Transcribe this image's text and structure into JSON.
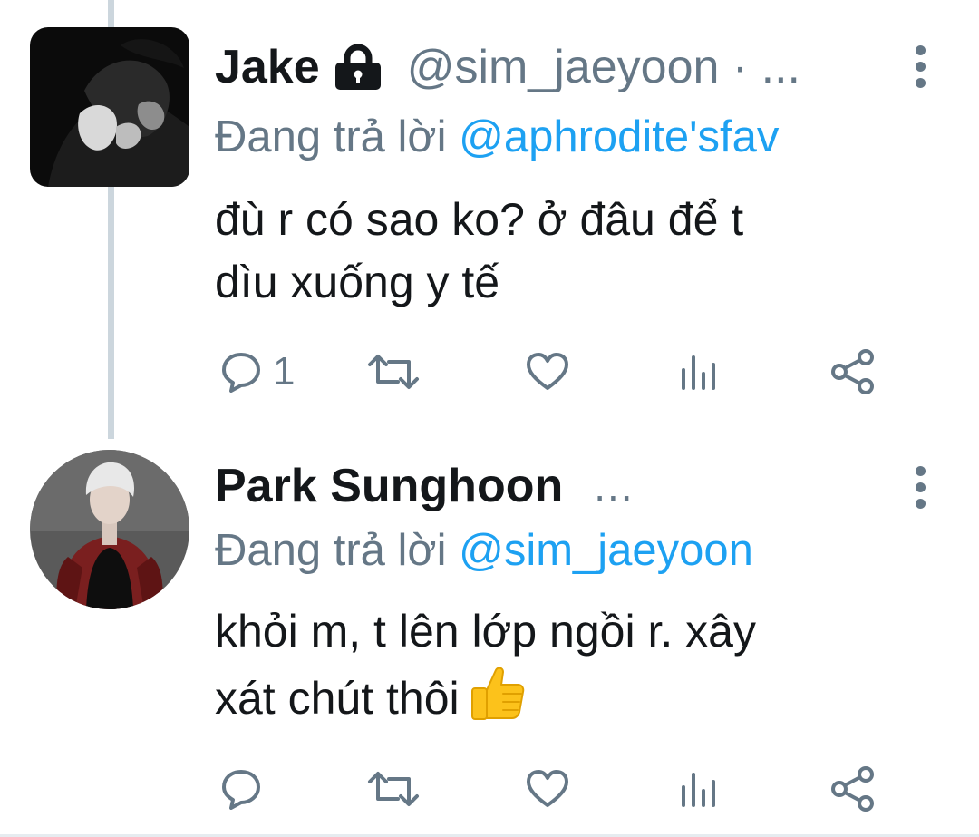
{
  "tweets": [
    {
      "name": "Jake",
      "protected_icon": "lock-icon",
      "handle": "@sim_jaeyoon · ...",
      "reply_prefix": "Đang trả lời ",
      "reply_to": "@aphrodite'sfav",
      "text_line1": "đù r có sao ko? ở đâu để t",
      "text_line2": "dìu xuống y tế",
      "reply_count": "1",
      "more_icon": "more-vertical-icon"
    },
    {
      "name": "Park Sunghoon",
      "name_suffix": "...",
      "reply_prefix": "Đang trả lời ",
      "reply_to": "@sim_jaeyoon",
      "text_line1": "khỏi m, t lên lớp ngồi r. xây",
      "text_line2": "xát chút thôi",
      "emoji": "thumbs-up-emoji",
      "reply_count": "",
      "more_icon": "more-vertical-icon"
    }
  ],
  "action_icons": [
    "reply-icon",
    "retweet-icon",
    "like-icon",
    "analytics-icon",
    "share-icon"
  ],
  "colors": {
    "text": "#14171a",
    "secondary": "#657786",
    "link": "#1da1f2",
    "thread_line": "#ccd6dd"
  }
}
